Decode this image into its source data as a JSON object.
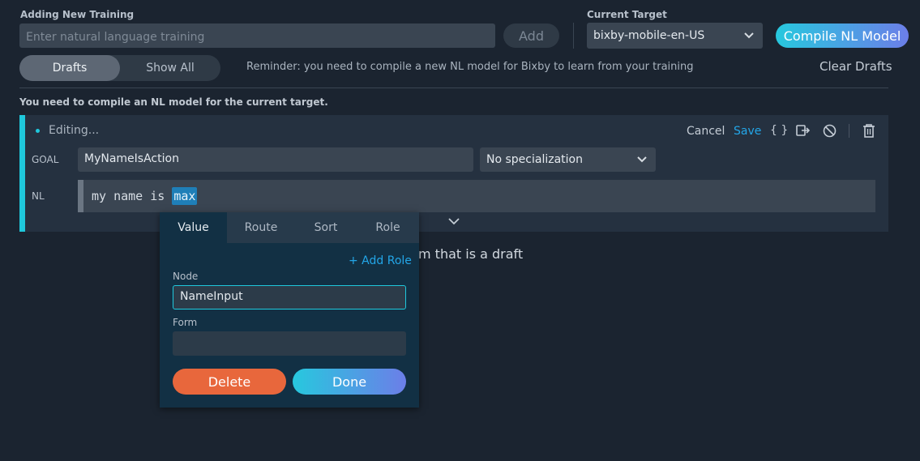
{
  "training": {
    "label": "Adding New Training",
    "placeholder": "Enter natural language training",
    "add_label": "Add"
  },
  "target": {
    "label": "Current Target",
    "value": "bixby-mobile-en-US"
  },
  "compile_label": "Compile NL Model",
  "filter": {
    "drafts_label": "Drafts",
    "show_all_label": "Show All"
  },
  "reminder": "Reminder: you need to compile a new NL model for Bixby to learn from your training",
  "clear_drafts_label": "Clear Drafts",
  "warning": "You need to compile an NL model for the current target.",
  "editor": {
    "status": "Editing...",
    "cancel_label": "Cancel",
    "save_label": "Save",
    "braces_label": "{ }",
    "goal_label": "GOAL",
    "goal_value": "MyNameIsAction",
    "specialization_value": "No specialization",
    "nl_label": "NL",
    "nl_words": [
      "my",
      "name",
      "is"
    ],
    "nl_highlight": "max"
  },
  "behind_text": "m that is a draft",
  "popup": {
    "tabs": [
      "Value",
      "Route",
      "Sort",
      "Role"
    ],
    "active_tab": "Value",
    "add_role_label": "+ Add Role",
    "node_label": "Node",
    "node_value": "NameInput",
    "form_label": "Form",
    "form_value": "",
    "delete_label": "Delete",
    "done_label": "Done"
  },
  "colors": {
    "accent": "#1fc8dc",
    "link": "#23a6e8",
    "delete": "#e8673c",
    "highlight": "#1f7fb8"
  }
}
